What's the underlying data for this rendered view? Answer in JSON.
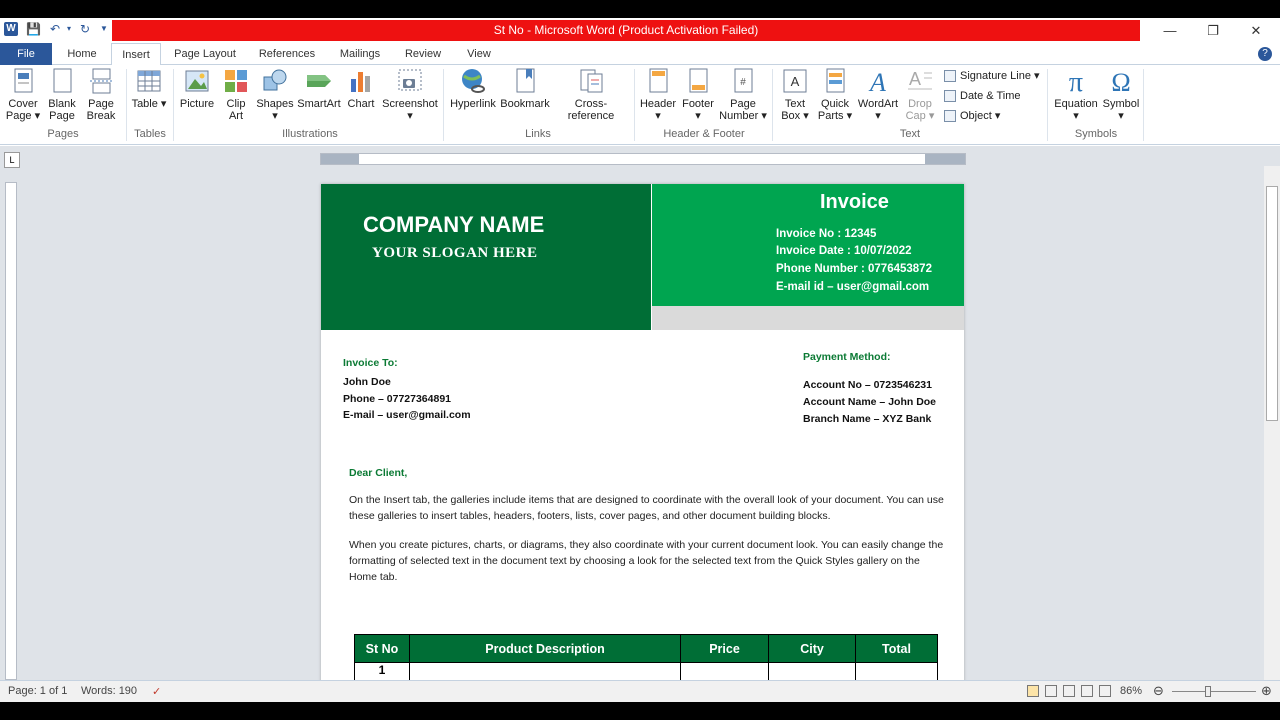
{
  "window": {
    "title": "St No  -  Microsoft Word (Product Activation Failed)"
  },
  "tabs": [
    {
      "label": "File"
    },
    {
      "label": "Home"
    },
    {
      "label": "Insert"
    },
    {
      "label": "Page Layout"
    },
    {
      "label": "References"
    },
    {
      "label": "Mailings"
    },
    {
      "label": "Review"
    },
    {
      "label": "View"
    }
  ],
  "ribbon": {
    "buttons": [
      {
        "label": "Cover Page ▾"
      },
      {
        "label": "Blank Page"
      },
      {
        "label": "Page Break"
      },
      {
        "label": "Table ▾"
      },
      {
        "label": "Picture"
      },
      {
        "label": "Clip Art"
      },
      {
        "label": "Shapes ▾"
      },
      {
        "label": "SmartArt"
      },
      {
        "label": "Chart"
      },
      {
        "label": "Screenshot ▾"
      },
      {
        "label": "Hyperlink"
      },
      {
        "label": "Bookmark"
      },
      {
        "label": "Cross-reference"
      },
      {
        "label": "Header ▾"
      },
      {
        "label": "Footer ▾"
      },
      {
        "label": "Page Number ▾"
      },
      {
        "label": "Text Box ▾"
      },
      {
        "label": "Quick Parts ▾"
      },
      {
        "label": "WordArt ▾"
      },
      {
        "label": "Drop Cap ▾"
      },
      {
        "label": "Equation ▾"
      },
      {
        "label": "Symbol ▾"
      }
    ],
    "small_buttons": [
      {
        "label": "Signature Line ▾"
      },
      {
        "label": "Date & Time"
      },
      {
        "label": "Object ▾"
      }
    ],
    "groups": [
      {
        "label": "Pages"
      },
      {
        "label": "Tables"
      },
      {
        "label": "Illustrations"
      },
      {
        "label": "Links"
      },
      {
        "label": "Header & Footer"
      },
      {
        "label": "Text"
      },
      {
        "label": "Symbols"
      }
    ]
  },
  "document": {
    "company_name": "COMPANY NAME",
    "slogan": "YOUR SLOGAN HERE",
    "invoice_title": "Invoice",
    "invoice_lines": [
      "Invoice No : 12345",
      "Invoice Date : 10/07/2022",
      "Phone Number : 0776453872",
      "E-mail id – user@gmail.com"
    ],
    "invoice_to_label": "Invoice To:",
    "client_lines": [
      "John Doe",
      "Phone – 07727364891",
      "E-mail – user@gmail.com"
    ],
    "payment_label": "Payment Method:",
    "payment_lines": [
      "Account No – 0723546231",
      "Account Name – John Doe",
      "Branch Name – XYZ Bank"
    ],
    "greeting": "Dear Client,",
    "paragraphs": [
      "On the Insert tab, the galleries include items that are designed to coordinate with the overall look of your document. You can use these galleries to insert tables, headers, footers, lists, cover pages, and other document building blocks.",
      "When you create pictures, charts, or diagrams, they also coordinate with your current document look. You can easily change the formatting of selected text in the document text by choosing a look for the selected text from the Quick Styles gallery on the Home tab."
    ],
    "table": {
      "headers": [
        "St No",
        "Product Description",
        "Price",
        "City",
        "Total"
      ],
      "rows": [
        [
          "1",
          "",
          "",
          "",
          ""
        ]
      ]
    }
  },
  "status": {
    "page": "Page: 1 of 1",
    "words": "Words: 190",
    "zoom": "86%"
  },
  "colors": {
    "dark_green": "#006e36",
    "bright_green": "#00a550",
    "title_red": "#ee1111",
    "word_blue": "#2b579a"
  }
}
